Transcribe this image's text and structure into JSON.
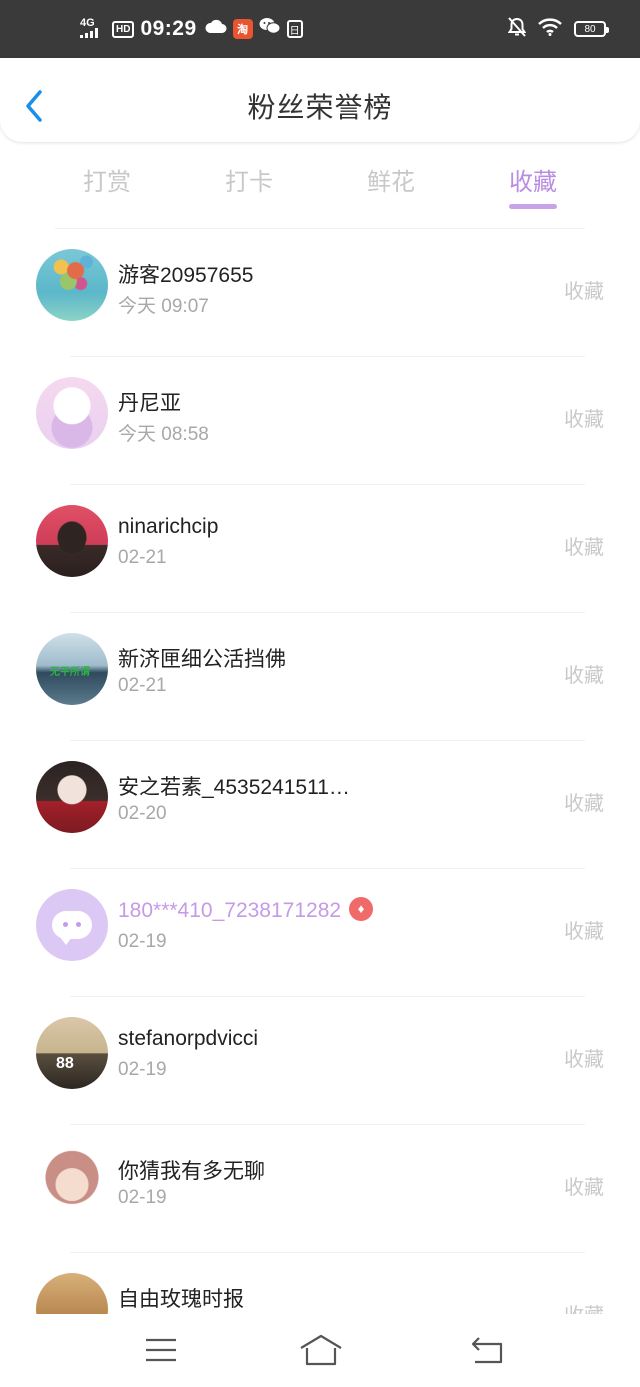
{
  "status_bar": {
    "network": "4G",
    "hd": "HD",
    "time": "09:29",
    "app_icon": "淘",
    "box_icon": "日",
    "battery": "80",
    "icons": [
      "signal-icon",
      "cloud-icon",
      "wechat-icon",
      "bell-off-icon",
      "wifi-icon",
      "battery-icon"
    ]
  },
  "header": {
    "title": "粉丝荣誉榜",
    "back_icon": "chevron-left-icon"
  },
  "tabs": [
    {
      "label": "打赏",
      "active": false
    },
    {
      "label": "打卡",
      "active": false
    },
    {
      "label": "鲜花",
      "active": false
    },
    {
      "label": "收藏",
      "active": true
    }
  ],
  "colors": {
    "accent": "#b98de2",
    "vip_name": "#c59ae6",
    "badge": "#f06a6a",
    "text_primary": "#222222",
    "text_secondary": "#a8a8a8",
    "status_bar": "#3a3a3a"
  },
  "fans": [
    {
      "name": "游客20957655",
      "date": "今天 09:07",
      "type": "收藏",
      "vip": false
    },
    {
      "name": "丹尼亚",
      "date": "今天 08:58",
      "type": "收藏",
      "vip": false
    },
    {
      "name": "ninarichcip",
      "date": "02-21",
      "type": "收藏",
      "vip": false
    },
    {
      "name": "新济匣细公活挡佛",
      "date": "02-21",
      "type": "收藏",
      "vip": false,
      "avatar_text": "无平所谓"
    },
    {
      "name": "安之若素_4535241511…",
      "date": "02-20",
      "type": "收藏",
      "vip": false
    },
    {
      "name": "180***410_7238171282",
      "date": "02-19",
      "type": "收藏",
      "vip": true
    },
    {
      "name": "stefanorpdvicci",
      "date": "02-19",
      "type": "收藏",
      "vip": false,
      "avatar_text": "88"
    },
    {
      "name": "你猜我有多无聊",
      "date": "02-19",
      "type": "收藏",
      "vip": false
    },
    {
      "name": "自由玫瑰时报",
      "date": "",
      "type": "收藏",
      "vip": false
    }
  ],
  "nav": {
    "icons": [
      "menu-icon",
      "home-icon",
      "back-icon"
    ]
  }
}
